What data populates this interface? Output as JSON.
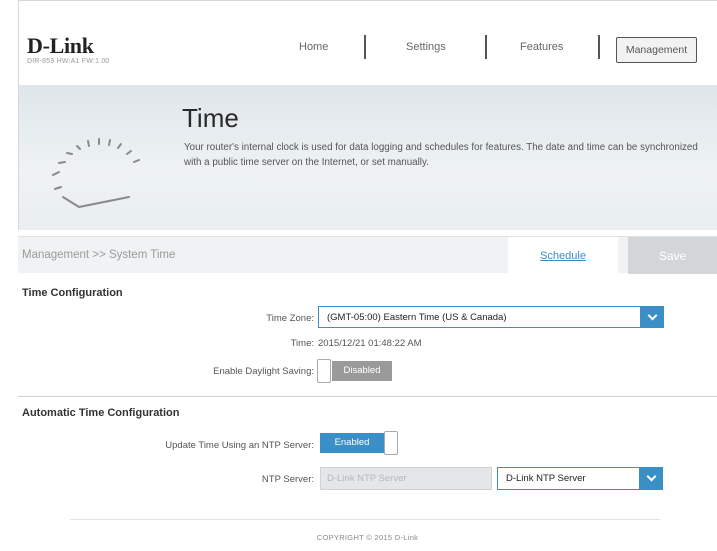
{
  "brand": {
    "logo": "D-Link",
    "model": "DIR-859 HW:A1 FW:1.00"
  },
  "nav": {
    "home": "Home",
    "settings": "Settings",
    "features": "Features",
    "management": "Management"
  },
  "hero": {
    "title": "Time",
    "description": "Your router's internal clock is used for data logging and schedules for features. The date and time can be synchronized with a public time server on the Internet, or set manually."
  },
  "breadcrumb": "Management >> System Time",
  "actions": {
    "schedule": "Schedule",
    "save": "Save"
  },
  "time_config": {
    "title": "Time Configuration",
    "time_zone_label": "Time Zone:",
    "time_zone_value": "(GMT-05:00) Eastern Time (US & Canada)",
    "time_label": "Time:",
    "time_value": "2015/12/21 01:48:22 AM",
    "dst_label": "Enable Daylight Saving:",
    "dst_state": "Disabled"
  },
  "auto_config": {
    "title": "Automatic Time Configuration",
    "ntp_update_label": "Update Time Using an NTP Server:",
    "ntp_update_state": "Enabled",
    "ntp_server_label": "NTP Server:",
    "ntp_server_input": "D-Link NTP Server",
    "ntp_server_select": "D-Link NTP Server"
  },
  "footer": "COPYRIGHT © 2015 D-Link",
  "colors": {
    "accent": "#3a8fc7",
    "disabled_toggle": "#9a9a9a",
    "save_bg": "#d3d6d8"
  }
}
